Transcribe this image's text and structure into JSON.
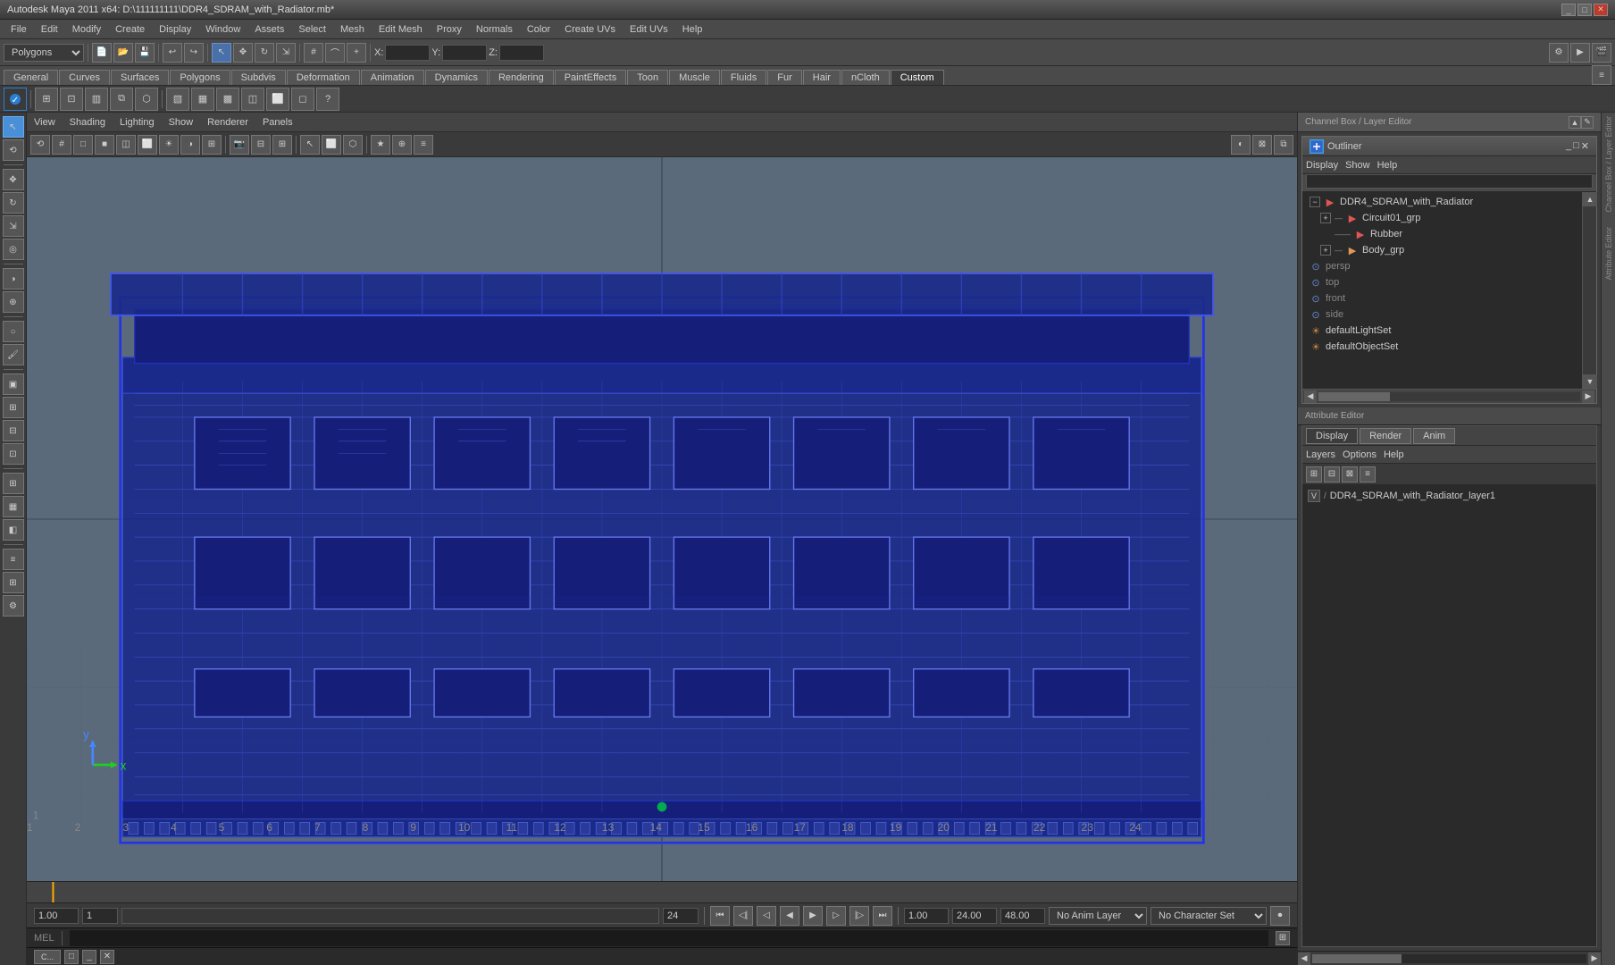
{
  "titlebar": {
    "title": "Autodesk Maya 2011 x64: D:\\111111111\\DDR4_SDRAM_with_Radiator.mb*",
    "minimize": "_",
    "maximize": "□",
    "close": "✕"
  },
  "menubar": {
    "items": [
      "File",
      "Edit",
      "Modify",
      "Create",
      "Display",
      "Window",
      "Assets",
      "Select",
      "Mesh",
      "Edit Mesh",
      "Proxy",
      "Normals",
      "Color",
      "Create UVs",
      "Edit UVs",
      "Help"
    ]
  },
  "toolbar": {
    "mode_dropdown": "Polygons",
    "x_label": "X:",
    "y_label": "Y:",
    "z_label": "Z:"
  },
  "shelf": {
    "tabs": [
      "General",
      "Curves",
      "Surfaces",
      "Polygons",
      "Subdvis",
      "Deformation",
      "Animation",
      "Dynamics",
      "Rendering",
      "PaintEffects",
      "Toon",
      "Muscle",
      "Fluids",
      "Fur",
      "Hair",
      "nCloth",
      "Custom"
    ],
    "active_tab": "Custom"
  },
  "viewport": {
    "menu_items": [
      "View",
      "Shading",
      "Lighting",
      "Show",
      "Renderer",
      "Panels"
    ],
    "model_name": "DDR4_SDRAM_with_Radiator"
  },
  "outliner": {
    "title": "Outliner",
    "menu_items": [
      "Display",
      "Show",
      "Help"
    ],
    "search_placeholder": "",
    "tree": [
      {
        "id": "ddr4",
        "label": "DDR4_SDRAM_with_Radiator",
        "level": 0,
        "expandable": true,
        "icon": "red"
      },
      {
        "id": "circuit01",
        "label": "Circuit01_grp",
        "level": 1,
        "expandable": true,
        "icon": "red"
      },
      {
        "id": "rubber",
        "label": "Rubber",
        "level": 2,
        "expandable": false,
        "icon": "red"
      },
      {
        "id": "body_grp",
        "label": "Body_grp",
        "level": 1,
        "expandable": true,
        "icon": "orange"
      },
      {
        "id": "persp",
        "label": "persp",
        "level": 0,
        "expandable": false,
        "icon": "sphere",
        "grayed": true
      },
      {
        "id": "top",
        "label": "top",
        "level": 0,
        "expandable": false,
        "icon": "sphere",
        "grayed": true
      },
      {
        "id": "front",
        "label": "front",
        "level": 0,
        "expandable": false,
        "icon": "sphere",
        "grayed": true
      },
      {
        "id": "side",
        "label": "side",
        "level": 0,
        "expandable": false,
        "icon": "sphere",
        "grayed": true
      },
      {
        "id": "defaultLightSet",
        "label": "defaultLightSet",
        "level": 0,
        "expandable": false,
        "icon": "sun"
      },
      {
        "id": "defaultObjectSet",
        "label": "defaultObjectSet",
        "level": 0,
        "expandable": false,
        "icon": "sun"
      }
    ]
  },
  "layer_editor": {
    "tabs": [
      "Display",
      "Render",
      "Anim"
    ],
    "active_tab": "Display",
    "menu_items": [
      "Layers",
      "Options",
      "Help"
    ],
    "layer": {
      "v": "V",
      "path": "/",
      "name": "DDR4_SDRAM_with_Radiator_layer1"
    }
  },
  "timeline": {
    "start": "1.00",
    "current": "1",
    "end": "24",
    "range_end": "24",
    "playback_start": "1.00",
    "playback_end": "24.00",
    "max_end": "48.00"
  },
  "transport": {
    "current_frame": "1.00"
  },
  "status": {
    "mel_label": "MEL",
    "anim_layer": "No Anim Layer",
    "character_set": "No Character Set"
  },
  "axis": {
    "x_color": "#22cc22",
    "y_color": "#4488ff",
    "labels": [
      "x",
      "y"
    ]
  }
}
